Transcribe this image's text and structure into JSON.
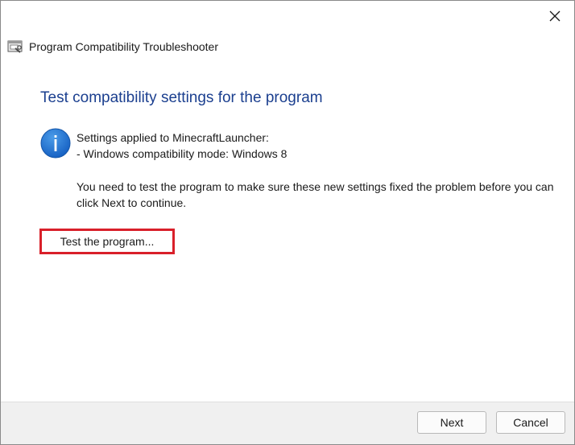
{
  "window": {
    "title": "Program Compatibility Troubleshooter",
    "icon": "troubleshooter-app-icon",
    "close_icon": "close-icon"
  },
  "main": {
    "heading": "Test compatibility settings for the program",
    "info_icon": "info-icon",
    "settings_line1": "Settings applied to MinecraftLauncher:",
    "settings_line2": "- Windows compatibility mode: Windows 8",
    "instruction": "You need to test the program to make sure these new settings fixed the problem before you can click Next to continue.",
    "test_button_label": "Test the program...",
    "highlight_color": "#d9202a",
    "heading_color": "#1b3f8f"
  },
  "footer": {
    "next_label": "Next",
    "cancel_label": "Cancel"
  }
}
